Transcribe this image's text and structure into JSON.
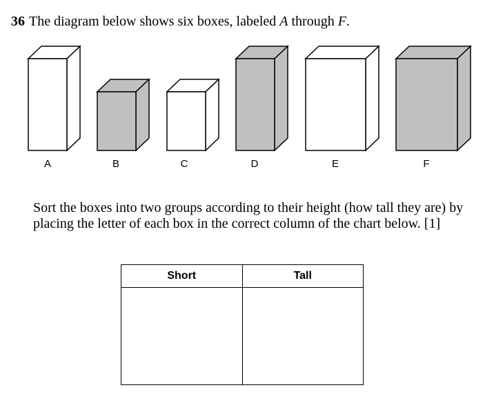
{
  "question": {
    "number": "36",
    "text_before": "The diagram below shows six boxes, labeled ",
    "first_letter": "A",
    "text_middle": " through ",
    "last_letter": "F",
    "text_after": "."
  },
  "boxes": [
    {
      "label": "A",
      "fill": "#ffffff"
    },
    {
      "label": "B",
      "fill": "#c0c0c0"
    },
    {
      "label": "C",
      "fill": "#ffffff"
    },
    {
      "label": "D",
      "fill": "#c0c0c0"
    },
    {
      "label": "E",
      "fill": "#ffffff"
    },
    {
      "label": "F",
      "fill": "#c0c0c0"
    }
  ],
  "instruction": "Sort the boxes into two groups according to their height (how tall they are) by placing the letter of each box in the correct column of the chart below.   [1]",
  "chart": {
    "headers": [
      "Short",
      "Tall"
    ],
    "cells": [
      "",
      ""
    ]
  }
}
